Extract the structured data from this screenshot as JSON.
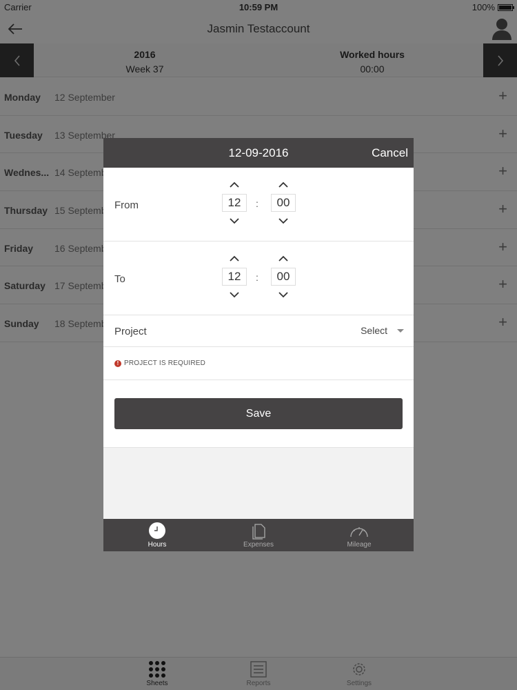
{
  "status": {
    "carrier": "Carrier",
    "time": "10:59 PM",
    "battery": "100%"
  },
  "nav": {
    "title": "Jasmin Testaccount"
  },
  "week": {
    "year": "2016",
    "week": "Week 37",
    "worked_label": "Worked hours",
    "worked_value": "00:00"
  },
  "days": [
    {
      "name": "Monday",
      "date": "12 September"
    },
    {
      "name": "Tuesday",
      "date": "13 September"
    },
    {
      "name": "Wednes...",
      "date": "14 September"
    },
    {
      "name": "Thursday",
      "date": "15 September"
    },
    {
      "name": "Friday",
      "date": "16 September"
    },
    {
      "name": "Saturday",
      "date": "17 September"
    },
    {
      "name": "Sunday",
      "date": "18 September"
    }
  ],
  "tabs": [
    {
      "label": "Sheets",
      "icon": "grid-icon"
    },
    {
      "label": "Reports",
      "icon": "list-icon"
    },
    {
      "label": "Settings",
      "icon": "gear-icon"
    }
  ],
  "modal": {
    "title": "12-09-2016",
    "cancel": "Cancel",
    "from": {
      "label": "From",
      "hour": "12",
      "minute": "00"
    },
    "to": {
      "label": "To",
      "hour": "12",
      "minute": "00"
    },
    "separator": ":",
    "project": {
      "label": "Project",
      "select": "Select"
    },
    "error": "PROJECT IS REQUIRED",
    "save": "Save",
    "tabs": [
      {
        "label": "Hours",
        "icon": "clock-icon"
      },
      {
        "label": "Expenses",
        "icon": "document-icon"
      },
      {
        "label": "Mileage",
        "icon": "speedometer-icon"
      }
    ]
  },
  "colors": {
    "dark": "#454344",
    "error": "#c0392b"
  }
}
